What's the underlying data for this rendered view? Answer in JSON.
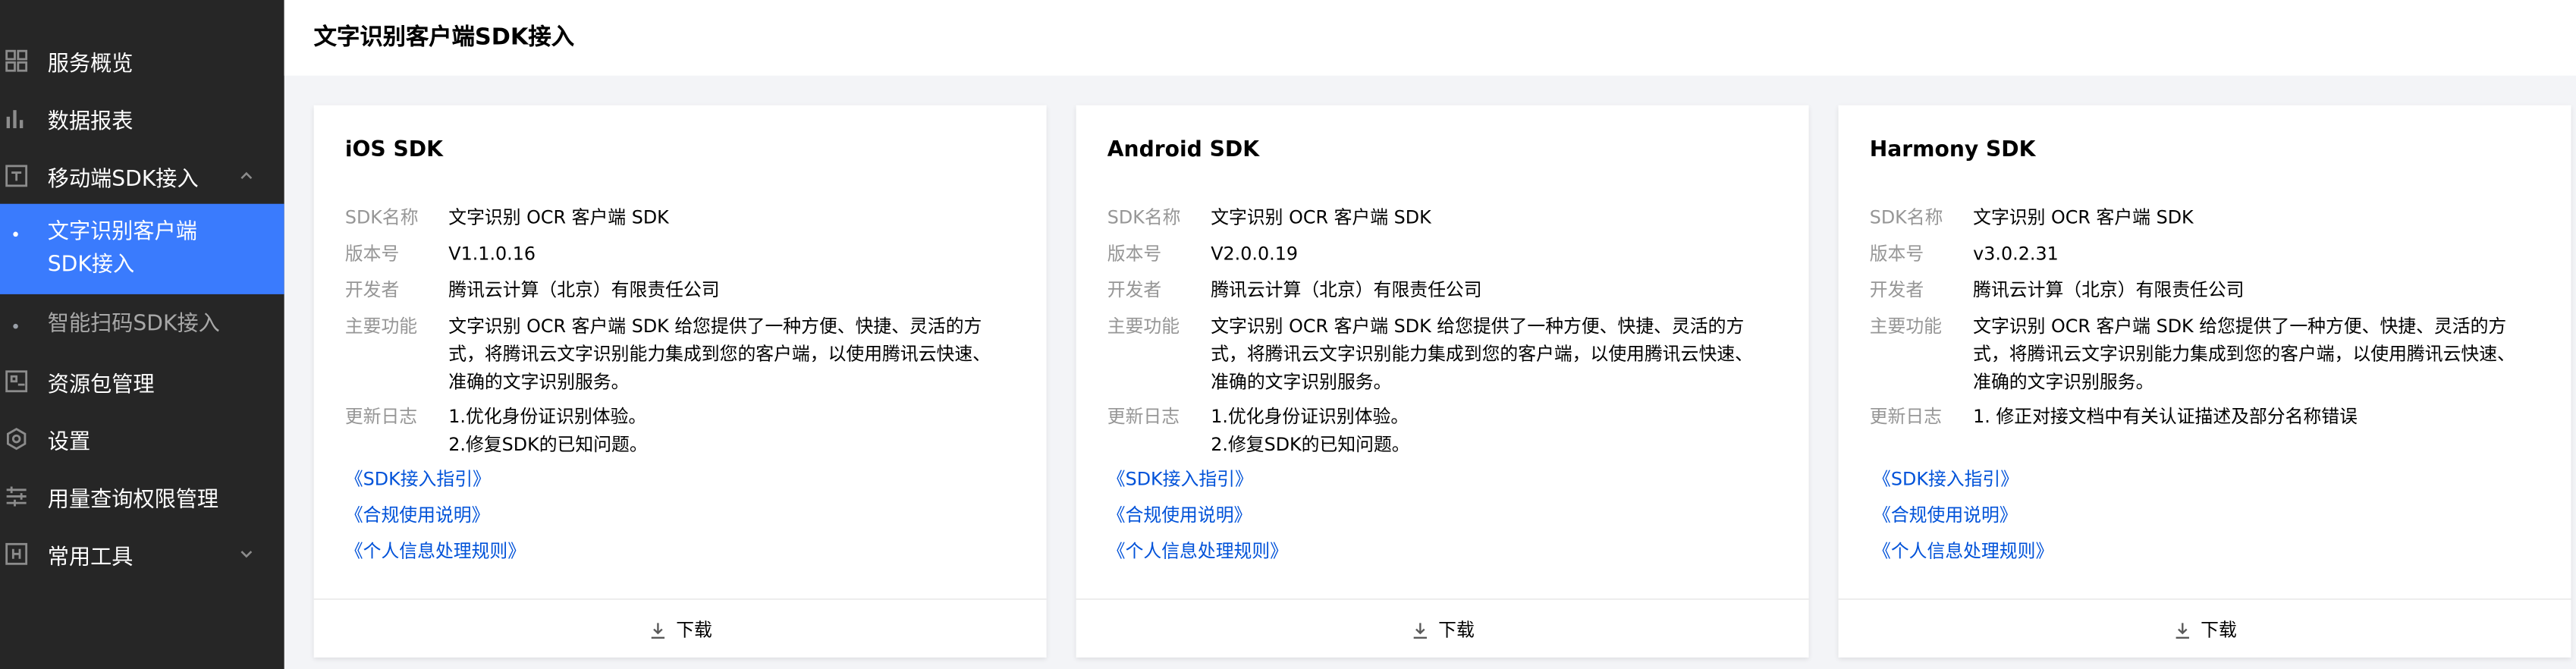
{
  "sidebar": {
    "items": [
      {
        "label": "服务概览",
        "icon": "grid-icon"
      },
      {
        "label": "数据报表",
        "icon": "bar-chart-icon"
      },
      {
        "label": "移动端SDK接入",
        "icon": "box-icon",
        "expanded": true
      },
      {
        "label": "资源包管理",
        "icon": "package-icon"
      },
      {
        "label": "设置",
        "icon": "settings-icon"
      },
      {
        "label": "用量查询权限管理",
        "icon": "sliders-icon"
      },
      {
        "label": "常用工具",
        "icon": "toolbox-icon",
        "expanded": false
      }
    ],
    "subitems": [
      {
        "label_line1": "文字识别客户端",
        "label_line2": "SDK接入",
        "active": true
      },
      {
        "label": "智能扫码SDK接入",
        "active": false
      }
    ]
  },
  "header": {
    "title": "文字识别客户端SDK接入"
  },
  "field_labels": {
    "name": "SDK名称",
    "version": "版本号",
    "developer": "开发者",
    "features": "主要功能",
    "changelog": "更新日志"
  },
  "cards": [
    {
      "title": "iOS SDK",
      "name": "文字识别 OCR 客户端 SDK",
      "version": "V1.1.0.16",
      "developer": "腾讯云计算（北京）有限责任公司",
      "features": "文字识别 OCR 客户端 SDK 给您提供了一种方便、快捷、灵活的方式，将腾讯云文字识别能力集成到您的客户端，以使用腾讯云快速、准确的文字识别服务。",
      "changelog": [
        "1.优化身份证识别体验。",
        "2.修复SDK的已知问题。"
      ],
      "links": [
        "《SDK接入指引》",
        "《合规使用说明》",
        "《个人信息处理规则》"
      ],
      "download_label": "下载"
    },
    {
      "title": "Android SDK",
      "name": "文字识别 OCR 客户端 SDK",
      "version": "V2.0.0.19",
      "developer": "腾讯云计算（北京）有限责任公司",
      "features": "文字识别 OCR 客户端 SDK 给您提供了一种方便、快捷、灵活的方式，将腾讯云文字识别能力集成到您的客户端，以使用腾讯云快速、准确的文字识别服务。",
      "changelog": [
        "1.优化身份证识别体验。",
        "2.修复SDK的已知问题。"
      ],
      "links": [
        "《SDK接入指引》",
        "《合规使用说明》",
        "《个人信息处理规则》"
      ],
      "download_label": "下载"
    },
    {
      "title": "Harmony SDK",
      "name": "文字识别 OCR 客户端 SDK",
      "version": "v3.0.2.31",
      "developer": "腾讯云计算（北京）有限责任公司",
      "features": "文字识别 OCR 客户端 SDK 给您提供了一种方便、快捷、灵活的方式，将腾讯云文字识别能力集成到您的客户端，以使用腾讯云快速、准确的文字识别服务。",
      "changelog": [
        "1. 修正对接文档中有关认证描述及部分名称错误"
      ],
      "links": [
        "《SDK接入指引》",
        "《合规使用说明》",
        "《个人信息处理规则》"
      ],
      "download_label": "下载"
    }
  ],
  "colors": {
    "sidebar_bg": "#262626",
    "active_bg": "#3a7bfd",
    "link": "#0052d9",
    "label_gray": "#969696",
    "content_bg": "#f3f4f7"
  }
}
